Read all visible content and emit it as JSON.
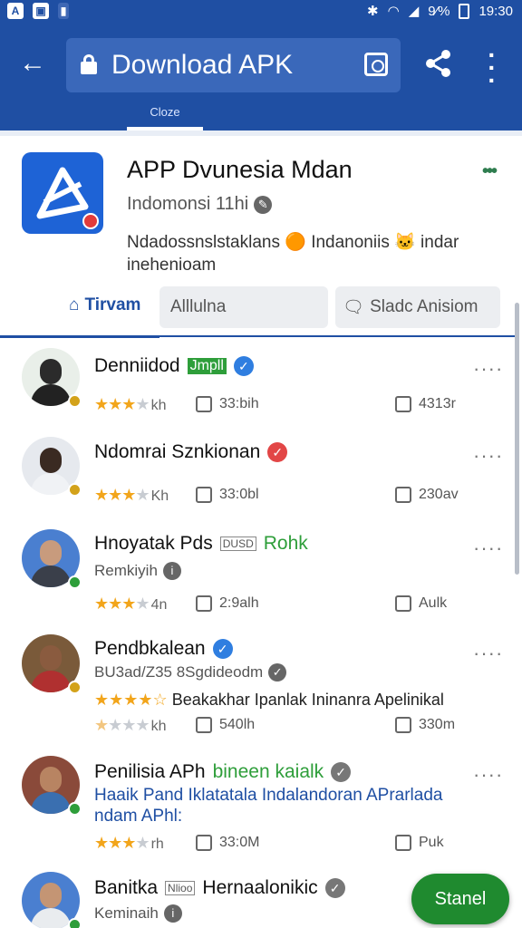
{
  "status_bar": {
    "left_icons": [
      "A",
      "▣",
      "▮"
    ],
    "battery_label": "9⁄%",
    "time": "19:30"
  },
  "app_bar": {
    "url_title": "Download APK",
    "sub_tab": "Cloze"
  },
  "app_header": {
    "title": "APP Dvunesia Mdan",
    "subtitle": "Indomonsi 11hi",
    "description": "Ndadossnslstaklans 🟠 Indanoniis 🐱 indar inehenioam"
  },
  "tabs": {
    "active": "Tirvam",
    "btn1": "Alllulna",
    "btn2": "Sladc Anisiom"
  },
  "reviews": [
    {
      "name": "Denniidod",
      "tag": "Jmpll",
      "stars_unit": "kh",
      "m2": "33:bih",
      "m3": "4313r"
    },
    {
      "name": "Ndomrai Sznkionan",
      "stars_unit": "Kh",
      "m2": "33:0bl",
      "m3": "230av"
    },
    {
      "name": "Hnoyatak Pds",
      "tag_box": "DUSD",
      "tag_green": "Rohk",
      "sub": "Remkiyih",
      "stars_unit": "4n",
      "m2": "2:9alh",
      "m3": "Aulk"
    },
    {
      "name": "Pendbkalean",
      "sub": "BU3ad/Z35 8Sgdideodm",
      "body": "Beakakhar Ipanlak Ininanra Apelinikal",
      "stars_unit": "kh",
      "m2": "540lh",
      "m3": "330m"
    },
    {
      "name": "Penilisia APh",
      "name_green": "bineen kaialk",
      "blue": "Haaik Pand Iklatatala Indalandoran APrarlada ndam APhl:",
      "stars_unit": "rh",
      "m2": "33:0M",
      "m3": "Puk"
    },
    {
      "name": "Banitka",
      "tag_box": "Nlioo",
      "rest": "Hernaalonikic",
      "sub": "Keminaih"
    }
  ],
  "fab_label": "Stanel"
}
